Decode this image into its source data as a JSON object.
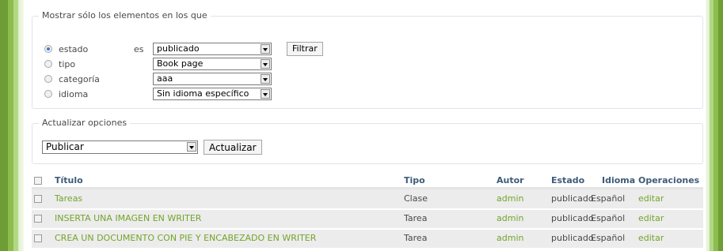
{
  "filter": {
    "legend": "Mostrar sólo los elementos en los que",
    "rows": [
      {
        "label": "estado",
        "selected": true,
        "operator": "es",
        "value": "publicado"
      },
      {
        "label": "tipo",
        "selected": false,
        "operator": "",
        "value": "Book page"
      },
      {
        "label": "categoría",
        "selected": false,
        "operator": "",
        "value": "aaa"
      },
      {
        "label": "idioma",
        "selected": false,
        "operator": "",
        "value": "Sin idioma específico"
      }
    ],
    "button": "Filtrar"
  },
  "update": {
    "legend": "Actualizar opciones",
    "select_value": "Publicar",
    "button": "Actualizar"
  },
  "table": {
    "headers": {
      "title": "Título",
      "type": "Tipo",
      "author": "Autor",
      "state": "Estado",
      "lang": "Idioma",
      "ops": "Operaciones"
    },
    "rows": [
      {
        "title": "Tareas",
        "type": "Clase",
        "author": "admin",
        "state": "publicado",
        "lang": "Español",
        "op": "editar"
      },
      {
        "title": "INSERTA UNA IMAGEN EN WRITER",
        "type": "Tarea",
        "author": "admin",
        "state": "publicado",
        "lang": "Español",
        "op": "editar"
      },
      {
        "title": "CREA UN DOCUMENTO CON PIE Y ENCABEZADO EN WRITER",
        "type": "Tarea",
        "author": "admin",
        "state": "publicado",
        "lang": "Español",
        "op": "editar"
      }
    ]
  },
  "colors": {
    "link": "#73a42b",
    "header_text": "#3e5b79",
    "stripe": "#8cbd4e"
  }
}
